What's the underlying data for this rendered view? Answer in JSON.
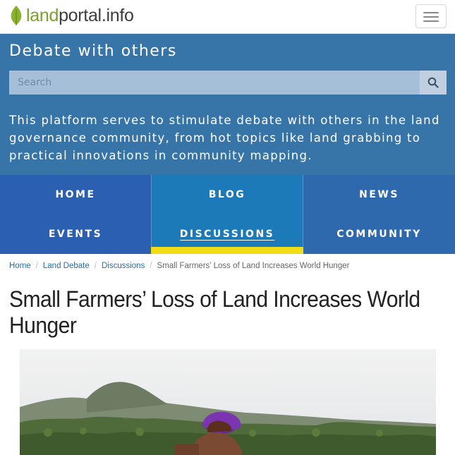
{
  "header": {
    "logo": {
      "land": "land",
      "rest": "portal.info",
      "leaf_icon": "leaf-icon"
    },
    "menu_icon": "hamburger-icon"
  },
  "band": {
    "title": "Debate with others",
    "search": {
      "placeholder": "Search",
      "value": "",
      "icon": "search-icon"
    },
    "description": "This platform serves to stimulate debate with others in the land governance community, from hot topics like land grabbing to practical innovations in community mapping.",
    "colors": {
      "band": "#3774a8",
      "active_indicator": "#f1dd16"
    }
  },
  "nav": {
    "items": [
      {
        "label": "HOME"
      },
      {
        "label": "BLOG"
      },
      {
        "label": "NEWS"
      },
      {
        "label": "EVENTS"
      },
      {
        "label": "DISCUSSIONS",
        "active": true
      },
      {
        "label": "COMMUNITY"
      }
    ]
  },
  "breadcrumb": {
    "items": [
      "Home",
      "Land Debate",
      "Discussions"
    ],
    "separator": "/",
    "current": "Small Farmers’ Loss of Land Increases World Hunger"
  },
  "article": {
    "title": "Small Farmers’ Loss of Land Increases World Hunger",
    "image": "farmer-field-photo"
  }
}
